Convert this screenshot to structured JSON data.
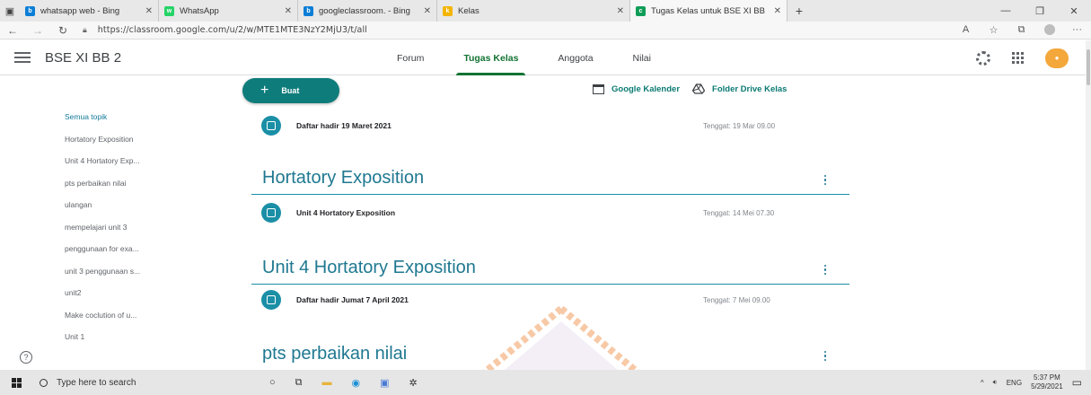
{
  "browser": {
    "tabs": [
      {
        "title": "whatsapp web - Bing",
        "favicon_color": "#0a7ed6",
        "favicon": "b"
      },
      {
        "title": "WhatsApp",
        "favicon_color": "#25d366",
        "favicon": "w"
      },
      {
        "title": "googleclassroom. - Bing",
        "favicon_color": "#0a7ed6",
        "favicon": "b"
      },
      {
        "title": "Kelas",
        "favicon_color": "#f4b400",
        "favicon": "k"
      },
      {
        "title": "Tugas Kelas untuk BSE XI BB",
        "favicon_color": "#0f9d58",
        "favicon": "c",
        "active": true
      }
    ],
    "url": "https://classroom.google.com/u/2/w/MTE1MTE3NzY2MjU3/t/all"
  },
  "header": {
    "class_name": "BSE XI BB 2",
    "tabs": [
      "Forum",
      "Tugas Kelas",
      "Anggota",
      "Nilai"
    ],
    "active_tab": "Tugas Kelas"
  },
  "toolbar": {
    "create_label": "Buat",
    "calendar_label": "Google Kalender",
    "drive_label": "Folder Drive Kelas"
  },
  "topics": [
    "Semua topik",
    "Hortatory Exposition",
    "Unit 4 Hortatory Exp...",
    "pts perbaikan nilai",
    "ulangan",
    "mempelajari unit 3",
    "penggunaan for exa...",
    "unit 3 penggunaan s...",
    "unit2",
    "Make coclution of u...",
    "Unit 1"
  ],
  "stream": {
    "item0": {
      "title": "Daftar hadir 19 Maret 2021",
      "due": "Tenggat: 19 Mar 09.00"
    },
    "section1": "Hortatory Exposition",
    "item1": {
      "title": "Unit 4 Hortatory Exposition",
      "due": "Tenggat: 14 Mei 07.30"
    },
    "section2": "Unit 4 Hortatory Exposition",
    "item2": {
      "title": "Daftar hadir Jumat 7 April 2021",
      "due": "Tenggat: 7 Mei 09.00"
    },
    "section3": "pts perbaikan nilai"
  },
  "taskbar": {
    "search_placeholder": "Type here to search",
    "language": "ENG",
    "time": "5:37 PM",
    "date": "5/29/2021"
  },
  "colors": {
    "accent": "#1f7891",
    "create_button": "#0f7c7c",
    "active_tab": "#137333"
  }
}
